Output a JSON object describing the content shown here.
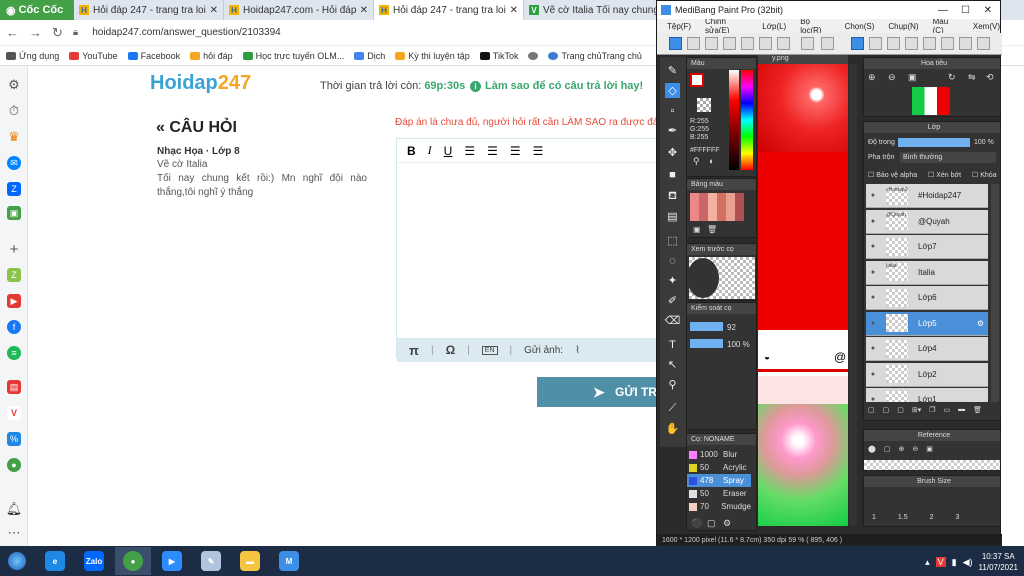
{
  "browser": {
    "brand": "Cốc Cốc",
    "tabs": [
      {
        "favicon": "H",
        "title": "Hỏi đáp 247 - trang tra loi",
        "active": false
      },
      {
        "favicon": "H",
        "title": "Hoidap247.com - Hỏi đáp or",
        "active": false
      },
      {
        "favicon": "H",
        "title": "Hỏi đáp 247 - trang tra loi",
        "active": true
      },
      {
        "favicon": "V",
        "title": "Vẽ cờ Italia Tối nay chung",
        "active": false
      }
    ],
    "url": "hoidap247.com/answer_question/2103394",
    "bookmarks": [
      {
        "label": "Ứng dụng",
        "color": "#555555"
      },
      {
        "label": "YouTube",
        "color": "#e53935"
      },
      {
        "label": "Facebook",
        "color": "#1877f2"
      },
      {
        "label": "hỏi đáp",
        "color": "#f5a623"
      },
      {
        "label": "Học trực tuyến OLM...",
        "color": "#2ea043"
      },
      {
        "label": "Dịch",
        "color": "#4285f4"
      },
      {
        "label": "Kỳ thi luyện tập",
        "color": "#f5a623"
      },
      {
        "label": "TikTok",
        "color": "#111111"
      },
      {
        "label": "Trang chủTrang chủ",
        "color": "#3a7bd5"
      }
    ]
  },
  "page": {
    "logo_main": "Hoidap",
    "logo_num": "247",
    "timer_label": "Thời gian trả lời còn: ",
    "timer_value": "69p:30s",
    "tip": "Làm sao để có câu trả lời hay!",
    "question_title": "« CÂU HỎI",
    "question_meta": "Nhạc Họa · Lớp 8",
    "question_line1": "Vẽ cờ Italia",
    "question_line2": "Tối nay chung kết rồi:) Mn nghĩ đội nào thắng,tôi nghĩ ý thắng",
    "warning": "Đáp án là chưa đủ, người hỏi rất cần LÀM SAO ra được đáp",
    "toolbar": {
      "bold": "B",
      "italic": "I",
      "underline": "U"
    },
    "footer": {
      "pi": "π",
      "omega": "Ω",
      "image_label": "Gửi ảnh:"
    },
    "submit_label": "GỬI TR"
  },
  "medibang": {
    "title": "MediBang Paint Pro (32bit)",
    "menu": [
      "Tệp(F)",
      "Chỉnh sửa(E)",
      "Lớp(L)",
      "Bộ lọc(R)",
      "Chọn(S)",
      "Chụp(N)",
      "Màu (C)",
      "Xem(V)"
    ],
    "color_panel": {
      "title": "Màu",
      "r": "R:255",
      "g": "G:255",
      "b": "B:255",
      "hex": "#FFFFFF"
    },
    "palette_title": "Bảng màu",
    "preview_title": "Xem trước cọ",
    "control_title": "Kiểm soát cọ",
    "brush_size": "92",
    "opacity": "100 %",
    "brush_panel_title": "Cọ: NONAME",
    "brushes": [
      {
        "size": "1000",
        "name": "Blur",
        "color": "#ff80ff"
      },
      {
        "size": "50",
        "name": "Acrylic",
        "color": "#e0d020"
      },
      {
        "size": "478",
        "name": "Spray",
        "color": "#3050e0",
        "selected": true
      },
      {
        "size": "50",
        "name": "Eraser",
        "color": "#e0e0e0"
      },
      {
        "size": "70",
        "name": "Smudge",
        "color": "#f0d0c0"
      }
    ],
    "doc_tab": "y.png",
    "navigator_title": "Hoa tiêu",
    "layer_title": "Lớp",
    "opacity_label": "Độ trong",
    "opacity_value": "100 %",
    "blend_label": "Pha trộn",
    "blend_value": "Bình thường",
    "checks": [
      "Bảo vệ alpha",
      "Xén bớt",
      "Khóa"
    ],
    "layers": [
      {
        "name": "#Hoidap247",
        "thumb_text": "#Hoidap247"
      },
      {
        "name": "@Quyah",
        "thumb_text": "@Quyah"
      },
      {
        "name": "Lớp7",
        "thumb_text": ""
      },
      {
        "name": "Italia",
        "thumb_text": "Italia"
      },
      {
        "name": "Lớp6",
        "thumb_text": ""
      },
      {
        "name": "Lớp5",
        "thumb_text": "",
        "selected": true
      },
      {
        "name": "Lớp4",
        "thumb_text": ""
      },
      {
        "name": "Lớp2",
        "thumb_text": ""
      },
      {
        "name": "Lớp1",
        "thumb_text": ""
      }
    ],
    "reference_title": "Reference",
    "brush_size_title": "Brush Size",
    "brush_sizes": [
      "1",
      "1.5",
      "2",
      "3"
    ],
    "status": "1600 * 1200 pixel   (11.6 * 8.7cm)   350 dpi   59 %   ( 895, 406 )"
  },
  "taskbar": {
    "time": "10:37 SA",
    "date": "11/07/2021"
  }
}
